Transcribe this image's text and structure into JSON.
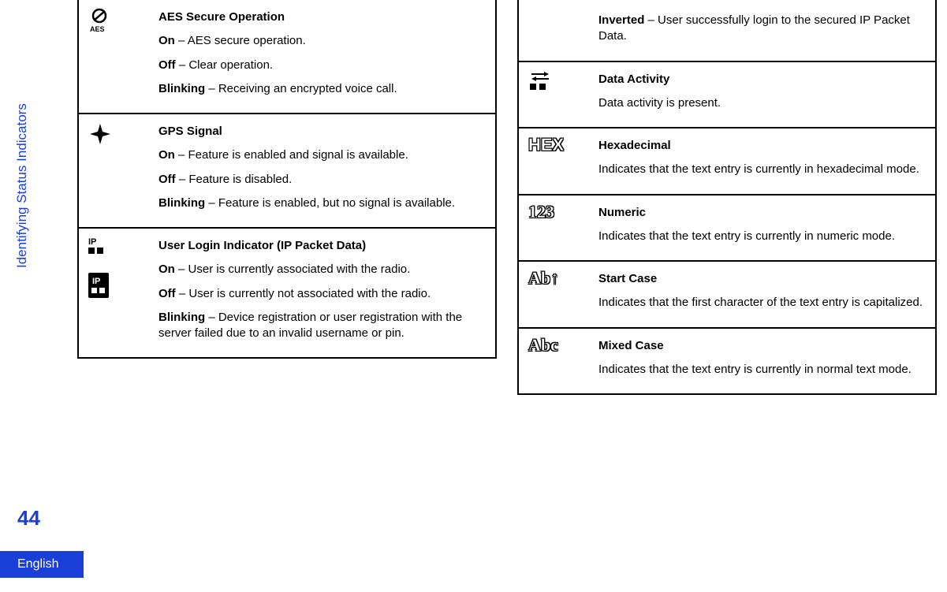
{
  "meta": {
    "section_label": "Identifying Status Indicators",
    "page_number": "44",
    "language": "English"
  },
  "left_column": [
    {
      "icon": "aes-icon",
      "title": "AES Secure Operation",
      "lines": [
        {
          "b": "On",
          "t": " – AES secure operation."
        },
        {
          "b": "Off",
          "t": " – Clear operation."
        },
        {
          "b": "Blinking",
          "t": " – Receiving an encrypted voice call."
        }
      ]
    },
    {
      "icon": "gps-icon",
      "title": "GPS Signal",
      "lines": [
        {
          "b": "On",
          "t": " – Feature is enabled and signal is available."
        },
        {
          "b": "Off",
          "t": " – Feature is disabled."
        },
        {
          "b": "Blinking",
          "t": " – Feature is enabled, but no signal is available."
        }
      ]
    },
    {
      "icon": "ip-icon",
      "title": "User Login Indicator (IP Packet Data)",
      "lines": [
        {
          "b": "On",
          "t": " – User is currently associated with the radio."
        },
        {
          "b": "Off",
          "t": " – User is currently not associated with the radio."
        },
        {
          "b": "Blinking",
          "t": " – Device registration or user registration with the server failed due to an invalid username or pin."
        }
      ]
    }
  ],
  "right_column": [
    {
      "icon": "none",
      "title": "",
      "lines": [
        {
          "b": "Inverted",
          "t": " – User successfully login to the secured IP Packet Data."
        }
      ]
    },
    {
      "icon": "data-activity-icon",
      "title": "Data Activity",
      "lines": [
        {
          "b": "",
          "t": "Data activity is present."
        }
      ]
    },
    {
      "icon": "hex-icon",
      "title": "Hexadecimal",
      "lines": [
        {
          "b": "",
          "t": "Indicates that the text entry is currently in hexadecimal mode."
        }
      ]
    },
    {
      "icon": "numeric-icon",
      "title": "Numeric",
      "lines": [
        {
          "b": "",
          "t": "Indicates that the text entry is currently in numeric mode."
        }
      ]
    },
    {
      "icon": "startcase-icon",
      "title": "Start Case",
      "lines": [
        {
          "b": "",
          "t": "Indicates that the first character of the text entry is capitalized."
        }
      ]
    },
    {
      "icon": "mixedcase-icon",
      "title": "Mixed Case",
      "lines": [
        {
          "b": "",
          "t": "Indicates that the text entry is currently in normal text mode."
        }
      ]
    }
  ]
}
